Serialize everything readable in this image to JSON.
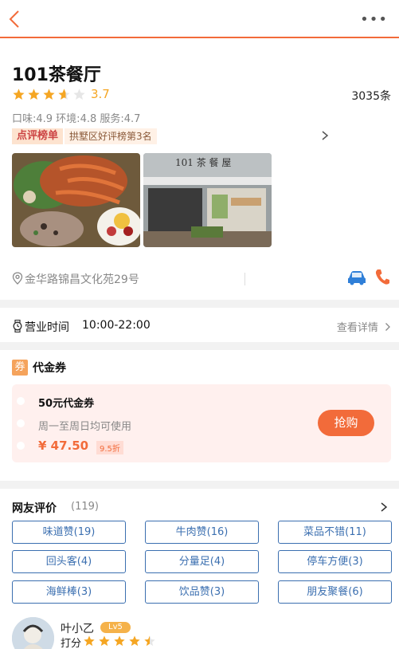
{
  "header": {
    "back_icon": "chevron-left-icon",
    "more_label": "•••"
  },
  "shop": {
    "name": "101茶餐厅",
    "rating": "3.7",
    "rating_value": 3.7,
    "review_count": "3035条",
    "subscores": "口味:4.9 环境:4.8 服务:4.7",
    "rank_badge": "点评榜单",
    "rank_text": "拱墅区好评榜第3名",
    "address": "金华路锦昌文化苑29号",
    "hours_label": "营业时间",
    "hours_value": "10:00-22:00",
    "hours_detail": "查看详情"
  },
  "photos": [
    {
      "subject": "seafood-platter"
    },
    {
      "subject": "storefront",
      "sign": "101 茶 餐 屋"
    }
  ],
  "voucher": {
    "icon_label": "券",
    "section_title": "代金券",
    "name": "50元代金券",
    "desc": "周一至周日均可使用",
    "price": "¥ 47.50",
    "discount": "9.5折",
    "buy_label": "抢购"
  },
  "reviews": {
    "title": "网友评价",
    "count": "(119)",
    "tags": [
      "味道赞(19)",
      "牛肉赞(16)",
      "菜品不错(11)",
      "回头客(4)",
      "分量足(4)",
      "停车方便(3)",
      "海鲜棒(3)",
      "饮品赞(3)",
      "朋友聚餐(6)"
    ]
  },
  "user": {
    "name": "叶小乙",
    "level": "Lv5",
    "score_label": "打分",
    "stars_value": 4.5
  },
  "colors": {
    "accent": "#f26b3a",
    "star": "#f5a623",
    "tag_blue": "#3b6fb0"
  }
}
